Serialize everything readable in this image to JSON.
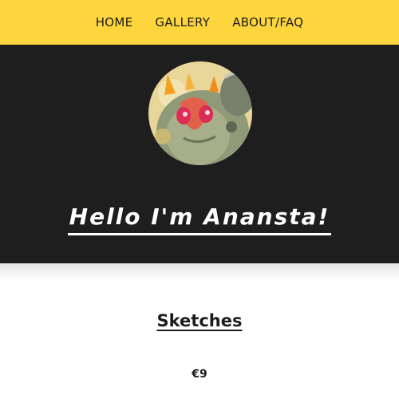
{
  "nav": {
    "items": [
      {
        "label": "HOME"
      },
      {
        "label": "GALLERY"
      },
      {
        "label": "ABOUT/FAQ"
      }
    ]
  },
  "hero": {
    "title": "Hello I'm Anansta!",
    "avatar_icon": "character-portrait-icon"
  },
  "section": {
    "title": "Sketches",
    "price": "€9"
  },
  "colors": {
    "nav_bg": "#fdd53d",
    "hero_bg": "#1e1e1e",
    "text": "#1c1c1c"
  }
}
